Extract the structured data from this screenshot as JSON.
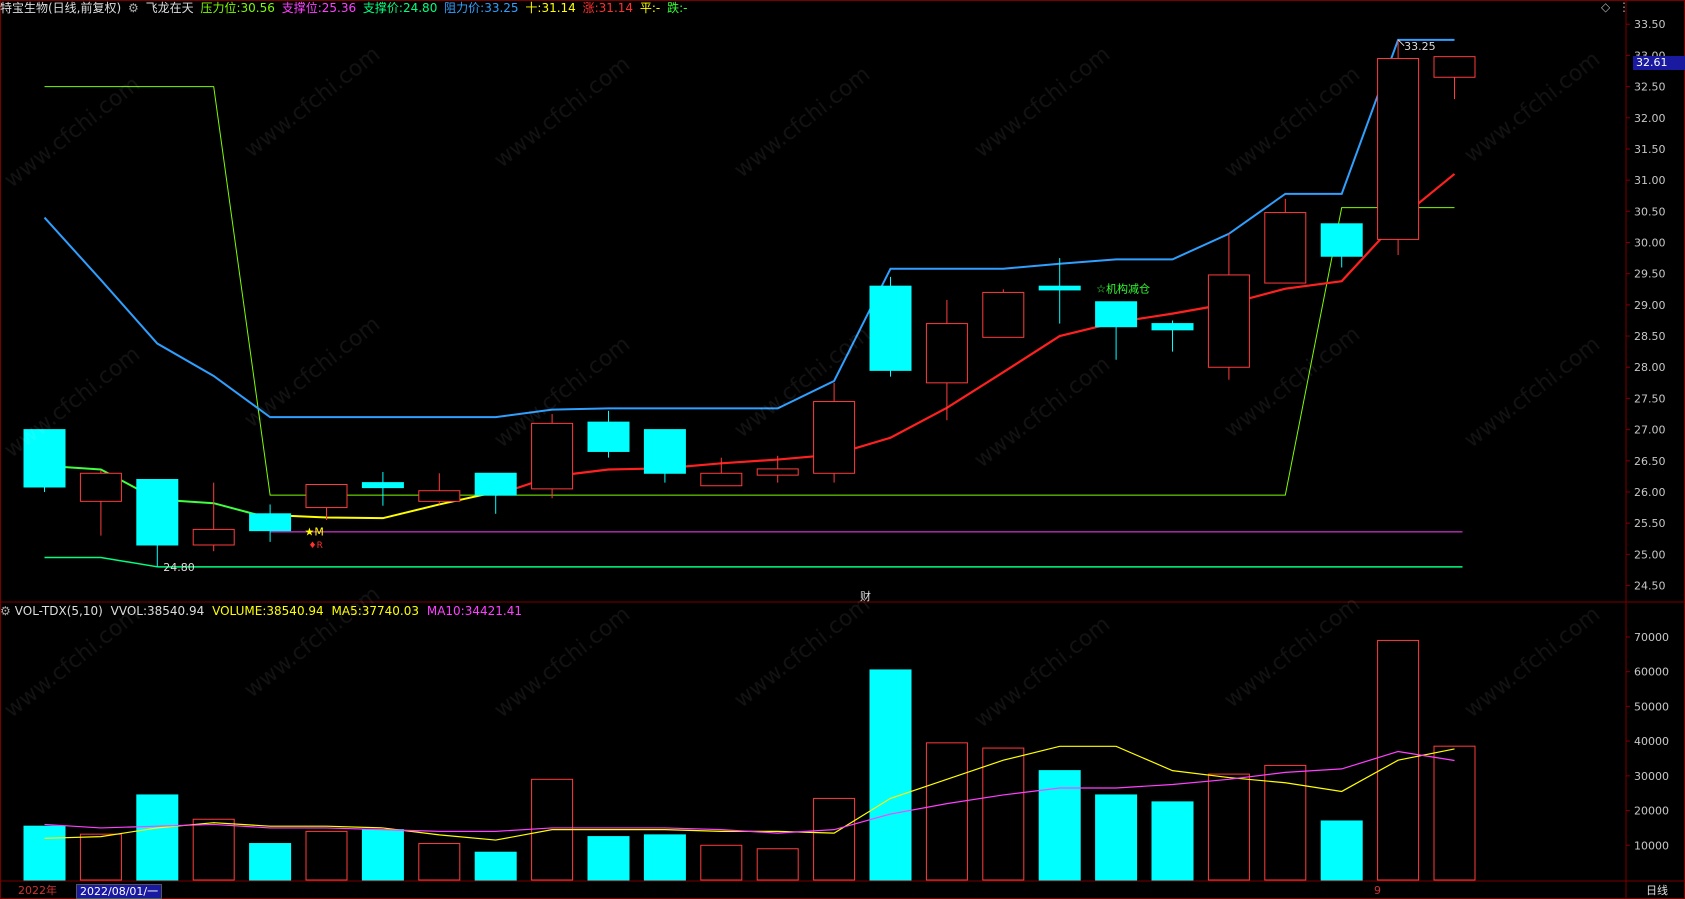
{
  "header": {
    "stock_name": "特宝生物(日线,前复权)",
    "indicator_name": "飞龙在天",
    "pressure_label": "压力位:",
    "pressure_value": "30.56",
    "support_label": "支撑位:",
    "support_value": "25.36",
    "support_price_label": "支撑价:",
    "support_price_value": "24.80",
    "resistance_label": "阻力价:",
    "resistance_value": "33.25",
    "ten_label": "十:",
    "ten_value": "31.14",
    "rise_label": "涨:",
    "rise_value": "31.14",
    "flat_label": "平:",
    "flat_value": "-",
    "fall_label": "跌:",
    "fall_value": "-"
  },
  "vol_header": {
    "name": "VOL-TDX(5,10)",
    "vvol_label": "VVOL:",
    "vvol_value": "38540.94",
    "volume_label": "VOLUME:",
    "volume_value": "38540.94",
    "ma5_label": "MA5:",
    "ma5_value": "37740.03",
    "ma10_label": "MA10:",
    "ma10_value": "34421.41"
  },
  "price_badge": "32.61",
  "annotations": {
    "high_label": "33.25",
    "low_label": "24.80",
    "star_m": "★M",
    "marker_r": "♦R",
    "institution_text": "☆机构减仓",
    "fin_marker": "财"
  },
  "bottom": {
    "year": "2022年",
    "date_input": "2022/08/01/一",
    "month_tick": "9",
    "period": "日线"
  },
  "watermark_text": "www.cfchi.com",
  "colors": {
    "up": "#ff3c3c",
    "down": "#00ffff",
    "blue_line": "#2fa0ff",
    "red_line": "#ff2020",
    "green_line": "#7cfc00",
    "yellow_line": "#ffff00",
    "purple_line": "#ff40ff",
    "support_line": "#00ff80",
    "grid": "#7a0000"
  },
  "chart_data": [
    {
      "type": "candlestick",
      "title": "特宝生物(日线,前复权)",
      "ylim": [
        24.3,
        33.6
      ],
      "yticks": [
        "33.50",
        "33.00",
        "32.50",
        "32.00",
        "31.50",
        "31.00",
        "30.50",
        "30.00",
        "29.50",
        "29.00",
        "28.50",
        "28.00",
        "27.50",
        "27.00",
        "26.50",
        "26.00",
        "25.50",
        "25.00",
        "24.50"
      ],
      "candles": [
        {
          "o": 27.0,
          "c": 26.08,
          "h": 27.0,
          "l": 26.0
        },
        {
          "o": 25.85,
          "c": 26.3,
          "h": 26.35,
          "l": 25.3
        },
        {
          "o": 26.2,
          "c": 25.15,
          "h": 26.2,
          "l": 24.8
        },
        {
          "o": 25.15,
          "c": 25.4,
          "h": 26.15,
          "l": 25.05
        },
        {
          "o": 25.65,
          "c": 25.38,
          "h": 25.8,
          "l": 25.2
        },
        {
          "o": 25.75,
          "c": 26.12,
          "h": 26.12,
          "l": 25.55
        },
        {
          "o": 26.15,
          "c": 26.07,
          "h": 26.32,
          "l": 25.78
        },
        {
          "o": 25.85,
          "c": 26.02,
          "h": 26.3,
          "l": 25.8
        },
        {
          "o": 26.3,
          "c": 25.95,
          "h": 26.3,
          "l": 25.65
        },
        {
          "o": 26.05,
          "c": 27.1,
          "h": 27.25,
          "l": 25.9
        },
        {
          "o": 27.12,
          "c": 26.65,
          "h": 27.3,
          "l": 26.55
        },
        {
          "o": 27.0,
          "c": 26.3,
          "h": 27.0,
          "l": 26.15
        },
        {
          "o": 26.1,
          "c": 26.3,
          "h": 26.55,
          "l": 26.1
        },
        {
          "o": 26.27,
          "c": 26.37,
          "h": 26.58,
          "l": 26.15
        },
        {
          "o": 26.3,
          "c": 27.45,
          "h": 27.75,
          "l": 26.15
        },
        {
          "o": 29.3,
          "c": 27.95,
          "h": 29.45,
          "l": 27.85
        },
        {
          "o": 27.75,
          "c": 28.7,
          "h": 29.08,
          "l": 27.15
        },
        {
          "o": 28.48,
          "c": 29.2,
          "h": 29.25,
          "l": 28.48
        },
        {
          "o": 29.3,
          "c": 29.24,
          "h": 29.75,
          "l": 28.7
        },
        {
          "o": 29.05,
          "c": 28.65,
          "h": 29.05,
          "l": 28.12
        },
        {
          "o": 28.7,
          "c": 28.6,
          "h": 28.75,
          "l": 28.25
        },
        {
          "o": 28.0,
          "c": 29.48,
          "h": 30.15,
          "l": 27.8
        },
        {
          "o": 29.35,
          "c": 30.48,
          "h": 30.7,
          "l": 29.35
        },
        {
          "o": 30.3,
          "c": 29.78,
          "h": 30.3,
          "l": 29.6
        },
        {
          "o": 30.05,
          "c": 32.95,
          "h": 33.25,
          "l": 29.8
        },
        {
          "o": 32.65,
          "c": 32.98,
          "h": 32.98,
          "l": 32.3
        }
      ],
      "red_ma": [
        null,
        null,
        null,
        null,
        null,
        null,
        null,
        null,
        25.95,
        26.25,
        26.36,
        26.38,
        26.46,
        26.52,
        26.6,
        26.87,
        27.35,
        27.92,
        28.5,
        28.72,
        28.86,
        29.02,
        29.26,
        29.38,
        30.36,
        31.1
      ],
      "yellow_line": [
        null,
        null,
        null,
        null,
        25.63,
        25.59,
        25.58,
        25.8,
        26.0
      ],
      "green_line": [
        26.42,
        26.36,
        25.88,
        25.82,
        25.58
      ],
      "blue_line": [
        30.4,
        29.4,
        28.38,
        27.86,
        27.2,
        27.2,
        27.2,
        27.2,
        27.2,
        27.32,
        27.34,
        27.34,
        27.34,
        27.34,
        27.78,
        29.58,
        29.58,
        29.58,
        29.66,
        29.73,
        29.73,
        30.14,
        30.78,
        30.78,
        33.25,
        33.25
      ],
      "pressure_line": [
        32.5,
        32.5,
        32.5,
        32.5,
        25.95,
        25.95,
        25.95,
        25.95,
        25.95,
        25.95,
        25.95,
        25.95,
        25.95,
        25.95,
        25.95,
        25.95,
        25.95,
        25.95,
        25.95,
        25.95,
        25.95,
        25.95,
        25.95,
        30.56,
        30.56,
        30.56
      ],
      "support_line": 25.36,
      "support_price_line": 24.8,
      "support_price_series": [
        24.95,
        24.95,
        24.8
      ]
    },
    {
      "type": "bar",
      "title": "VOL-TDX(5,10)",
      "ylim": [
        0,
        72000
      ],
      "yticks": [
        "70000",
        "60000",
        "50000",
        "40000",
        "30000",
        "20000",
        "10000"
      ],
      "values": [
        15500,
        13200,
        24500,
        17500,
        10500,
        14000,
        14500,
        10500,
        8000,
        29000,
        12500,
        13000,
        10000,
        9000,
        23500,
        60500,
        39500,
        38000,
        31500,
        24500,
        22500,
        30500,
        33000,
        17000,
        69000,
        38540
      ],
      "up": [
        false,
        true,
        false,
        true,
        false,
        true,
        false,
        true,
        false,
        true,
        false,
        false,
        true,
        true,
        true,
        false,
        true,
        true,
        false,
        false,
        false,
        true,
        true,
        false,
        true,
        true
      ],
      "ma5": [
        12000,
        12500,
        15000,
        16500,
        15500,
        15500,
        15000,
        13000,
        11500,
        14500,
        14500,
        14500,
        14000,
        14000,
        13500,
        23500,
        29000,
        34500,
        38500,
        38500,
        31500,
        29500,
        28000,
        25500,
        34500,
        37740
      ],
      "ma10": [
        16000,
        15000,
        15500,
        16000,
        15000,
        15000,
        14500,
        14000,
        14000,
        15000,
        15000,
        15000,
        14500,
        13500,
        14500,
        19000,
        22000,
        24500,
        26500,
        26500,
        27500,
        29000,
        31000,
        32000,
        37000,
        34421
      ]
    }
  ]
}
